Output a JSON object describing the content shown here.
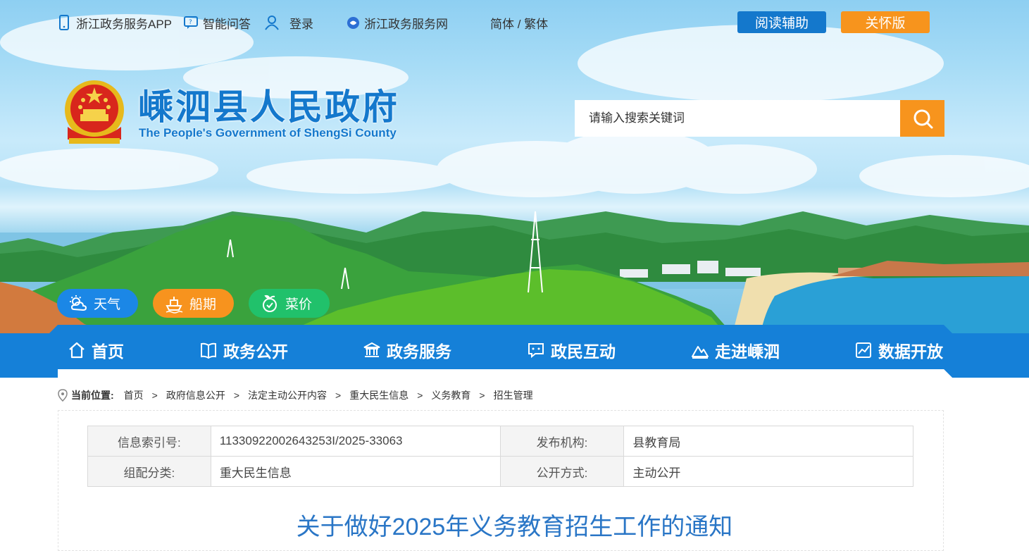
{
  "topbar": {
    "links": [
      {
        "label": "浙江政务服务APP",
        "icon": "phone-icon"
      },
      {
        "label": "智能问答",
        "icon": "chat-icon"
      },
      {
        "label": "登录",
        "icon": "user-icon"
      },
      {
        "label": "浙江政务服务网",
        "icon": "zj-logo-icon"
      }
    ],
    "lang_switch": "简体 / 繁体",
    "reading_aid": "阅读辅助",
    "care_version": "关怀版"
  },
  "site": {
    "title": "嵊泗县人民政府",
    "subtitle": "The People's Government of ShengSi County"
  },
  "search": {
    "placeholder": "请输入搜索关键词"
  },
  "quick": [
    {
      "label": "天气",
      "icon": "weather-icon",
      "color": "#1b87e6"
    },
    {
      "label": "船期",
      "icon": "ship-icon",
      "color": "#f7931e"
    },
    {
      "label": "菜价",
      "icon": "vegetable-icon",
      "color": "#21c16b"
    }
  ],
  "nav": [
    {
      "label": "首页",
      "icon": "home-icon"
    },
    {
      "label": "政务公开",
      "icon": "book-icon"
    },
    {
      "label": "政务服务",
      "icon": "building-icon"
    },
    {
      "label": "政民互动",
      "icon": "message-icon"
    },
    {
      "label": "走进嵊泗",
      "icon": "mountain-icon"
    },
    {
      "label": "数据开放",
      "icon": "chart-icon"
    }
  ],
  "breadcrumb": {
    "label": "当前位置:",
    "items": [
      "首页",
      "政府信息公开",
      "法定主动公开内容",
      "重大民生信息",
      "义务教育",
      "招生管理"
    ]
  },
  "meta": {
    "index_key": "信息索引号:",
    "index_value": "11330922002643253I/2025-33063",
    "publisher_key": "发布机构:",
    "publisher_value": "县教育局",
    "category_key": "组配分类:",
    "category_value": "重大民生信息",
    "mode_key": "公开方式:",
    "mode_value": "主动公开"
  },
  "document": {
    "title": "关于做好2025年义务教育招生工作的通知"
  },
  "colors": {
    "brand_blue": "#1478cc",
    "nav_blue": "#1580d8",
    "orange": "#f7941d",
    "green": "#21c16b",
    "title_blue": "#2a76c6"
  }
}
